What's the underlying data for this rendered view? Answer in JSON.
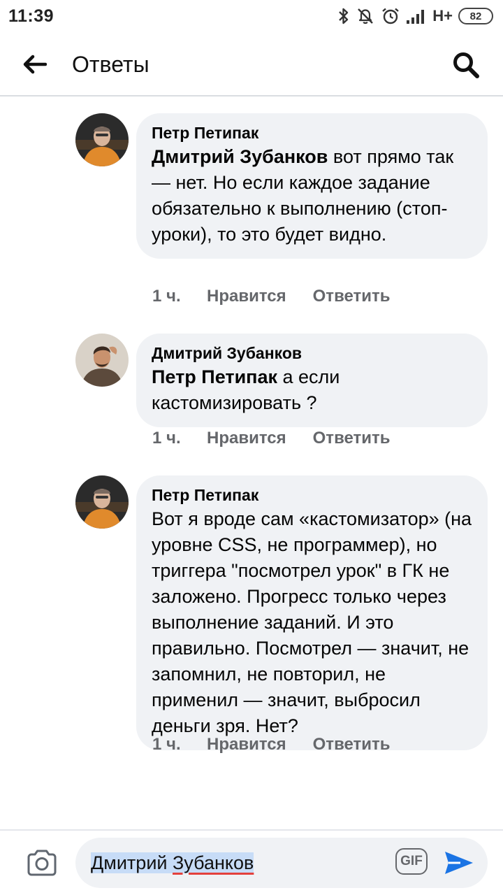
{
  "status_bar": {
    "time": "11:39",
    "network": "H+",
    "battery": "82",
    "icons": [
      "bluetooth-icon",
      "mute-icon",
      "alarm-icon",
      "signal-icon"
    ]
  },
  "header": {
    "title": "Ответы",
    "back_icon": "arrow-left-icon",
    "search_icon": "search-icon"
  },
  "comments": [
    {
      "author": "Петр Петипак",
      "mention": "Дмитрий Зубанков",
      "text": " вот прямо так — нет. Но если каждое задание обязательно к выполнению (стоп-уроки), то это будет видно.",
      "time": "1 ч.",
      "like_label": "Нравится",
      "reply_label": "Ответить"
    },
    {
      "author": "Дмитрий Зубанков",
      "mention": "Петр Петипак",
      "text": " а если кастомизировать ?",
      "time": "1 ч.",
      "like_label": "Нравится",
      "reply_label": "Ответить"
    },
    {
      "author": "Петр Петипак",
      "mention": "",
      "text": "Вот я вроде сам «кастомизатор» (на уровне CSS, не программер), но триггера \"посмотрел урок\" в ГК не заложено. Прогресс только через выполнение заданий. И это правильно. Посмотрел — значит, не запомнил, не повторил, не применил — значит, выбросил деньги зря. Нет?",
      "time": "1 ч.",
      "like_label": "Нравится",
      "reply_label": "Ответить"
    }
  ],
  "composer": {
    "input_first_name": "Дмитрий",
    "input_last_name": "Зубанков",
    "gif_label": "GIF",
    "camera_icon": "camera-icon",
    "send_icon": "send-icon"
  },
  "colors": {
    "bubble_bg": "#f0f2f5",
    "meta_text": "#65676b",
    "send_blue": "#1b74e4",
    "selection": "#c7dcf7",
    "spellcheck_red": "#e4413d"
  }
}
